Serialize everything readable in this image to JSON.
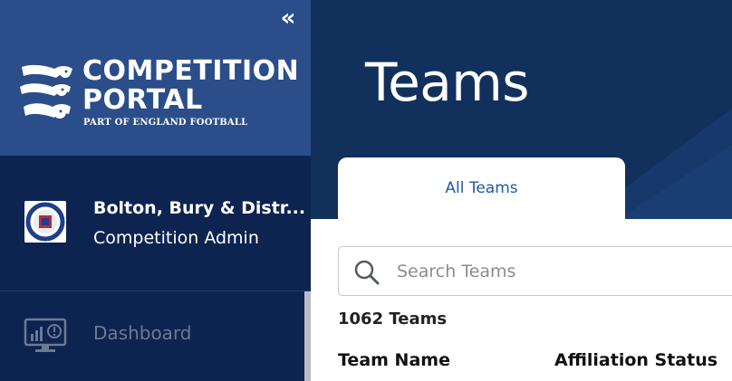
{
  "sidebar": {
    "brand": {
      "title_line1": "COMPETITION",
      "title_line2": "PORTAL",
      "subtitle": "PART OF ENGLAND FOOTBALL"
    },
    "collapse_glyph": "«",
    "organisation": {
      "name": "Bolton, Bury & Distr...",
      "role": "Competition Admin"
    },
    "nav": [
      {
        "label": "Dashboard",
        "icon": "dashboard-monitor-icon"
      }
    ]
  },
  "header": {
    "title": "Teams"
  },
  "tabs": [
    {
      "label": "All Teams",
      "active": true
    }
  ],
  "search": {
    "value": "",
    "placeholder": "Search Teams"
  },
  "results": {
    "count_text": "1062 Teams"
  },
  "table": {
    "columns": [
      "Team Name",
      "Affiliation Status"
    ]
  },
  "colors": {
    "sidebar_bg": "#0d2350",
    "brand_bg": "#2b4e8a",
    "header_bg": "#11305c",
    "accent": "#1f5aa6"
  }
}
